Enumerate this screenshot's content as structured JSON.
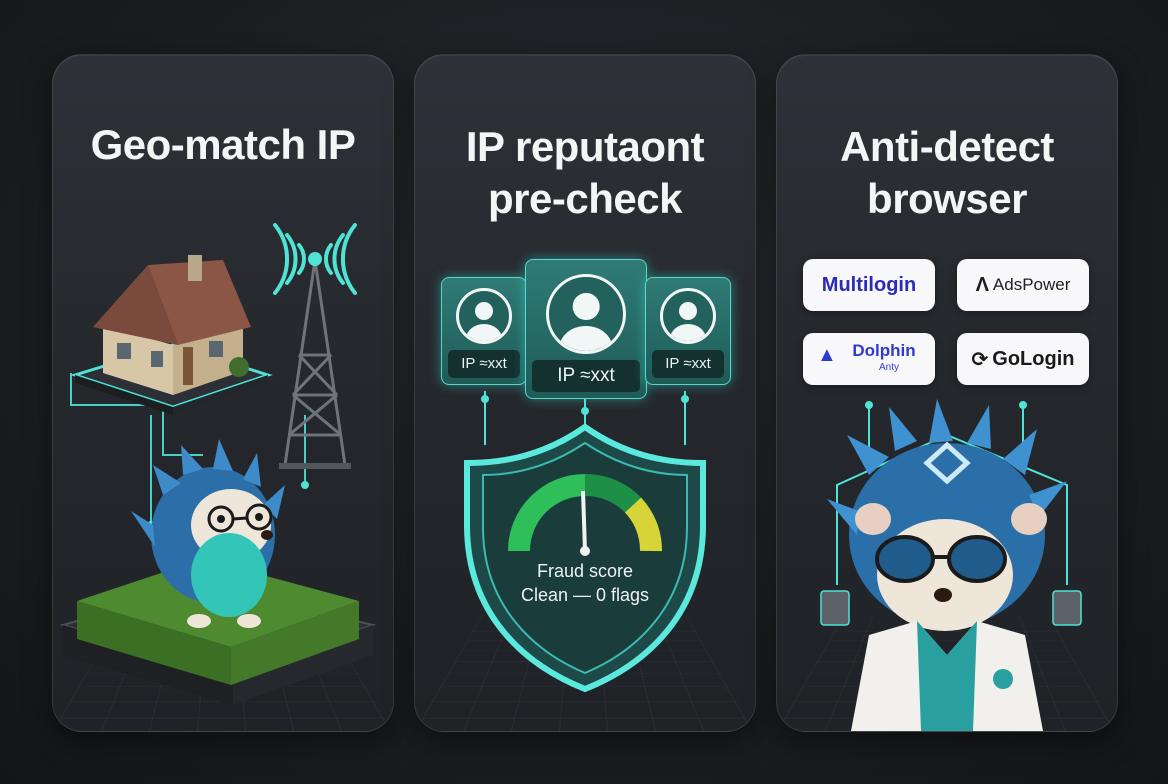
{
  "panels": [
    {
      "title_line1": "Geo-match IP",
      "title_line2": ""
    },
    {
      "title_line1": "IP reputaont",
      "title_line2": "pre-check"
    },
    {
      "title_line1": "Anti-detect",
      "title_line2": "browser"
    }
  ],
  "profile_cards": [
    {
      "label": "IP ≈xxt"
    },
    {
      "label": "IP ≈xxt"
    },
    {
      "label": "IP ≈xxt"
    }
  ],
  "fraud": {
    "line1": "Fraud score",
    "line2": "Clean — 0 flags"
  },
  "browsers": {
    "multilogin": "Multilogin",
    "adspower": "AdsPower",
    "dolphin": "Dolphin",
    "dolphin_sub": "Anty",
    "gologin": "GoLogin"
  },
  "colors": {
    "accent": "#4fe3d6",
    "background": "#1e2024",
    "gauge_green": "#2fbf5a",
    "gauge_yellow": "#d7d43a"
  },
  "icons": [
    "house-icon",
    "radio-tower-icon",
    "hedgehog-icon",
    "shield-icon",
    "gauge-icon",
    "user-avatar-icon",
    "hedgehog-scientist-icon"
  ]
}
